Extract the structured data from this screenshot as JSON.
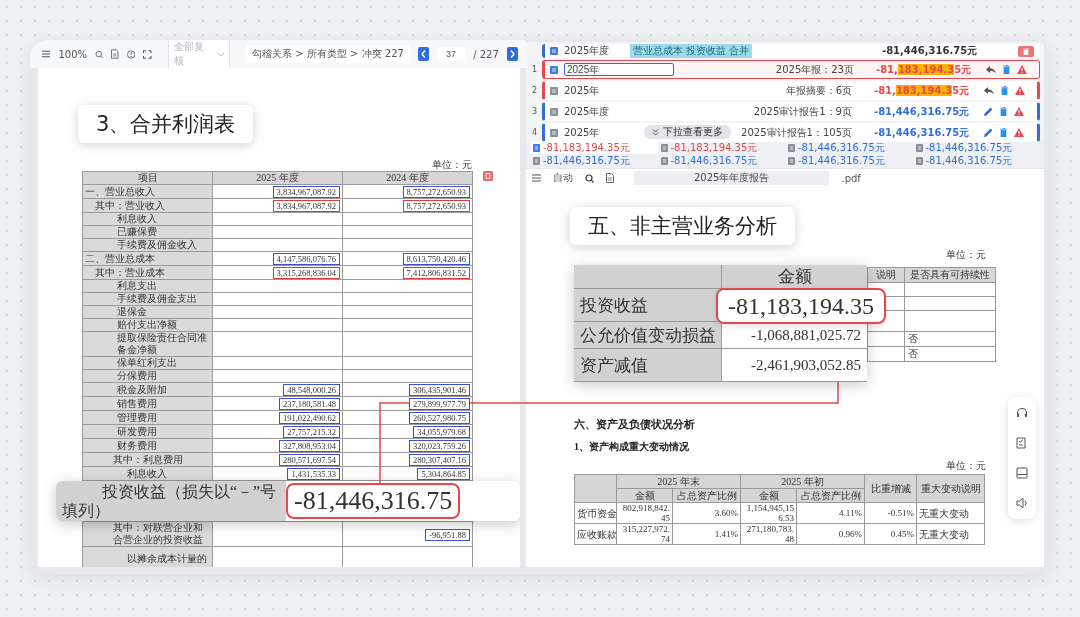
{
  "left_viewer": {
    "toolbar": {
      "zoom": "100%",
      "filter_placeholder": "全部复核",
      "path": "勾稽关系 > 所有类型 > 冲突 227",
      "page": "37",
      "total": "/ 227"
    },
    "callout": "3、合并利润表",
    "unit": "单位：元",
    "table": {
      "columns": [
        "项目",
        "2025 年度",
        "2024 年度"
      ],
      "rows": [
        {
          "kind": "top",
          "label": "一、营业总收入",
          "cells": [
            {
              "text": "3,834,967,087.92",
              "color": "#3d4fd6"
            },
            {
              "text": "8,757,272,650.93",
              "color": "#3d4fd6"
            }
          ]
        },
        {
          "kind": "sub",
          "label": "其中：营业收入",
          "cells": [
            {
              "text": "3,834,967,087.92",
              "color": "#e03a3a"
            },
            {
              "text": "8,757,272,650.93",
              "color": "#e03a3a"
            }
          ]
        },
        {
          "kind": "item",
          "label": "利息收入"
        },
        {
          "kind": "item",
          "label": "已赚保费"
        },
        {
          "kind": "item",
          "label": "手续费及佣金收入"
        },
        {
          "kind": "top",
          "label": "二、营业总成本",
          "cells": [
            {
              "text": "4,147,586,076.76",
              "color": "#3d4fd6"
            },
            {
              "text": "8,613,750,420.46",
              "color": "#3d4fd6"
            }
          ]
        },
        {
          "kind": "sub",
          "label": "其中：营业成本",
          "cells": [
            {
              "text": "3,315,268,836.04",
              "color": "#e03a3a"
            },
            {
              "text": "7,412,806,831.52",
              "color": "#e03a3a"
            }
          ]
        },
        {
          "kind": "item",
          "label": "利息支出"
        },
        {
          "kind": "item",
          "label": "手续费及佣金支出"
        },
        {
          "kind": "item",
          "label": "退保金"
        },
        {
          "kind": "item",
          "label": "赔付支出净额"
        },
        {
          "kind": "item",
          "label": "提取保险责任合同准备金净额"
        },
        {
          "kind": "item",
          "label": "保单红利支出"
        },
        {
          "kind": "item",
          "label": "分保费用"
        },
        {
          "kind": "item",
          "label": "税金及附加",
          "cells": [
            {
              "text": "48,548,000.26",
              "color": "#3d4fd6"
            },
            {
              "text": "306,435,901.46",
              "color": "#3d4fd6"
            }
          ]
        },
        {
          "kind": "item",
          "label": "销售费用",
          "cells": [
            {
              "text": "237,180,581.48",
              "color": "#3d4fd6"
            },
            {
              "text": "279,899,977.79",
              "color": "#3d4fd6"
            }
          ]
        },
        {
          "kind": "item",
          "label": "管理费用",
          "cells": [
            {
              "text": "191,022,490.62",
              "color": "#3d4fd6"
            },
            {
              "text": "260,527,980.75",
              "color": "#3d4fd6"
            }
          ]
        },
        {
          "kind": "item",
          "label": "研发费用",
          "cells": [
            {
              "text": "27,757,215.32",
              "color": "#3d4fd6"
            },
            {
              "text": "34,055,979.68",
              "color": "#3d4fd6"
            }
          ]
        },
        {
          "kind": "item",
          "label": "财务费用",
          "cells": [
            {
              "text": "327,808,953.04",
              "color": "#3d4fd6"
            },
            {
              "text": "320,023,759.26",
              "color": "#3d4fd6"
            }
          ]
        },
        {
          "kind": "sub2",
          "label": "其中：利息费用",
          "cells": [
            {
              "text": "280,571,697.54",
              "color": "#3d4fd6"
            },
            {
              "text": "280,307,407.16",
              "color": "#3d4fd6"
            }
          ]
        },
        {
          "kind": "item2",
          "label": "利息收入",
          "cells": [
            {
              "text": "1,431,535.33",
              "color": "#3d4fd6"
            },
            {
              "text": "5,304,864.85",
              "color": "#3d4fd6"
            }
          ]
        }
      ],
      "zoom_row": {
        "label": "投资收益（损失以“－”号填列）",
        "value": "-81,446,316.75"
      },
      "rows_after": [
        {
          "kind": "sub2",
          "label": "其中：对联营企业和合营企业的投资收益",
          "cells": [
            null,
            {
              "text": "-96,951.88",
              "color": "#3d4fd6"
            }
          ]
        },
        {
          "kind": "item2",
          "label": "以摊余成本计量的"
        }
      ]
    }
  },
  "match_panel": {
    "summary": {
      "period": "2025年度",
      "tag": "营业总成本 投资收益 合并",
      "amount": "-81,446,316.75元"
    },
    "items": [
      {
        "number": "1",
        "selected": true,
        "editing": true,
        "conflict": true,
        "period": "2025年",
        "source": "2025年报：23页",
        "amount_parts": [
          {
            "text": "-81,",
            "highlight": false
          },
          {
            "text": "183,194.3",
            "highlight": true
          },
          {
            "text": "5元",
            "highlight": false
          }
        ]
      },
      {
        "number": "2",
        "selected": false,
        "editing": false,
        "conflict": true,
        "period": "2025年",
        "source": "年报摘要：6页",
        "amount_parts": [
          {
            "text": "-81,",
            "highlight": false
          },
          {
            "text": "183,194.3",
            "highlight": true
          },
          {
            "text": "5元",
            "highlight": false
          }
        ]
      },
      {
        "number": "3",
        "selected": false,
        "editing": false,
        "conflict": false,
        "period": "2025年度",
        "source": "2025审计报告1：9页",
        "amount_parts": [
          {
            "text": "-81,446,316.75元",
            "highlight": false
          }
        ]
      },
      {
        "number": "4",
        "selected": false,
        "editing": false,
        "conflict": false,
        "period": "2025年",
        "source": "2025审计报告1：105页",
        "amount_parts": [
          {
            "text": "-81,446,316.75元",
            "highlight": false
          }
        ]
      }
    ],
    "more_hint": "下拉查看更多",
    "value_tabs": [
      {
        "text": "-81,183,194.35元",
        "conflict": true,
        "selected": true
      },
      {
        "text": "-81,183,194.35元",
        "conflict": true,
        "selected": false
      },
      {
        "text": "-81,446,316.75元",
        "conflict": false,
        "selected": false
      },
      {
        "text": "-81,446,316.75元",
        "conflict": false,
        "selected": false
      },
      {
        "text": "-81,446,316.75元",
        "conflict": false,
        "selected": false
      },
      {
        "text": "-81,446,316.75元",
        "conflict": false,
        "selected": false
      },
      {
        "text": "-81,446,316.75元",
        "conflict": false,
        "selected": false
      },
      {
        "text": "-81,446,316.75元",
        "conflict": false,
        "selected": false
      }
    ]
  },
  "report_viewer": {
    "toolbar": {
      "mode": "自动",
      "file": "2025年年度报告",
      "ext": ".pdf"
    },
    "callout": "五、非主营业务分析",
    "unit": "单位：元",
    "zoom_table": {
      "header": "金额",
      "rows": [
        {
          "label": "投资收益",
          "value": "-81,183,194.35",
          "highlight": true
        },
        {
          "label": "公允价值变动损益",
          "value": "-1,068,881,025.72",
          "highlight": false
        },
        {
          "label": "资产减值",
          "value": "-2,461,903,052.85",
          "highlight": false
        }
      ]
    },
    "side_table": {
      "columns": [
        "说明",
        "是否具有可持续性"
      ],
      "rows": [
        {
          "value": null
        },
        {
          "value": null
        },
        {
          "value": null
        },
        {
          "value": "否"
        },
        {
          "value": "否"
        }
      ]
    },
    "heading": "六、资产及负债状况分析",
    "subheading": "1、资产构成重大变动情况",
    "unit2": "单位：元",
    "asset_table": {
      "groups": [
        "2025 年末",
        "2025 年初"
      ],
      "sub_columns": [
        "金额",
        "占总资产比例",
        "金额",
        "占总资产比例"
      ],
      "extra_columns": [
        "比重增减",
        "重大变动说明"
      ],
      "rows": [
        {
          "label": "货币资金",
          "cells": [
            "802,918,842.45",
            "3.60%",
            "1,154,945,156.53",
            "4.11%",
            "-0.51%",
            "无重大变动"
          ]
        },
        {
          "label": "应收账款",
          "cells": [
            "315,227,972.74",
            "1.41%",
            "271,180,783.48",
            "0.96%",
            "0.45%",
            "无重大变动"
          ]
        }
      ]
    }
  }
}
